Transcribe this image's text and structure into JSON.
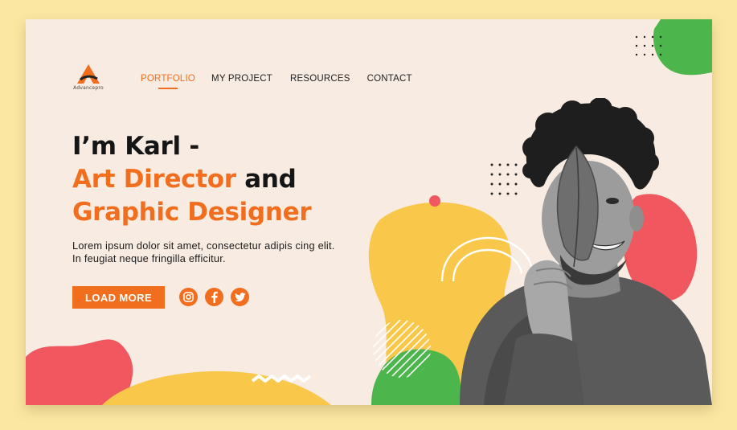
{
  "brand": {
    "name": "Advancepro",
    "logo_letter": "A"
  },
  "nav": {
    "items": [
      {
        "label": "PORTFOLIO",
        "active": true
      },
      {
        "label": "MY PROJECT",
        "active": false
      },
      {
        "label": "RESOURCES",
        "active": false
      },
      {
        "label": "CONTACT",
        "active": false
      }
    ]
  },
  "hero": {
    "line1": "I’m Karl -",
    "line2_orange": "Art Director",
    "line2_rest": " and",
    "line3": "Graphic Designer",
    "description": "Lorem ipsum dolor sit amet, consectetur adipis cing elit. In feugiat neque fringilla efficitur.",
    "button_label": "LOAD MORE"
  },
  "socials": [
    {
      "icon": "instagram-icon"
    },
    {
      "icon": "facebook-icon"
    },
    {
      "icon": "twitter-icon"
    }
  ],
  "colors": {
    "page_bg": "#fbe7a2",
    "card_bg": "#f8ebe1",
    "accent": "#f26e1f",
    "yellow": "#f9c84a",
    "green": "#4cb54b",
    "red": "#f0575f"
  }
}
